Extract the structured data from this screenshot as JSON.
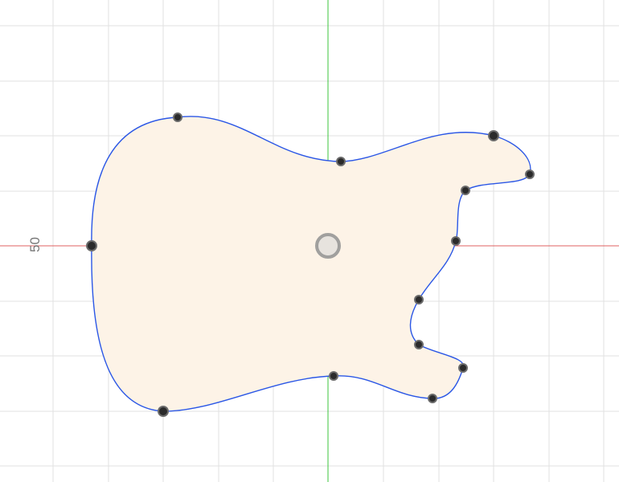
{
  "viewport": {
    "ruler_label": "50",
    "colors": {
      "background": "#ffffff",
      "grid": "#e2e2e2",
      "x_axis": "#e06060",
      "y_axis": "#3cc43c",
      "profile_stroke": "#2b57e6",
      "profile_fill": "#fdf3e7",
      "point": "#2b2b2b"
    }
  },
  "sketch": {
    "shape": "guitar-body-profile",
    "point_count": 14
  }
}
